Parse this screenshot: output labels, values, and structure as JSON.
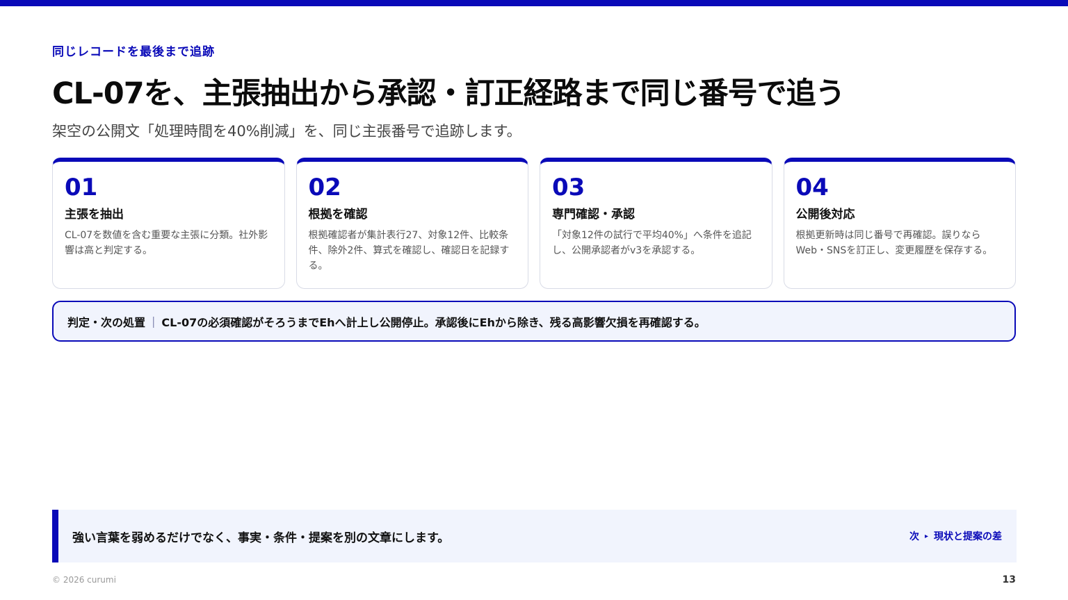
{
  "header": {
    "eyebrow": "同じレコードを最後まで追跡",
    "title": "CL-07を、主張抽出から承認・訂正経路まで同じ番号で追う",
    "subtitle": "架空の公開文「処理時間を40%削減」を、同じ主張番号で追跡します。"
  },
  "steps": [
    {
      "num": "01",
      "title": "主張を抽出",
      "body": "CL-07を数値を含む重要な主張に分類。社外影響は高と判定する。"
    },
    {
      "num": "02",
      "title": "根拠を確認",
      "body": "根拠確認者が集計表行27、対象12件、比較条件、除外2件、算式を確認し、確認日を記録する。"
    },
    {
      "num": "03",
      "title": "専門確認・承認",
      "body": "「対象12件の試行で平均40%」へ条件を追記し、公開承認者がv3を承認する。"
    },
    {
      "num": "04",
      "title": "公開後対応",
      "body": "根拠更新時は同じ番号で再確認。誤りならWeb・SNSを訂正し、変更履歴を保存する。"
    }
  ],
  "verdict": {
    "label": "判定・次の処置",
    "separator": "|",
    "text": "CL-07の必須確認がそろうまでEhへ計上し公開停止。承認後にEhから除き、残る高影響欠損を再確認する。"
  },
  "footer": {
    "message": "強い言葉を弱めるだけでなく、事実・条件・提案を別の文章にします。",
    "next_prefix": "次",
    "next_arrow": "▸",
    "next_label": "現状と提案の差"
  },
  "meta": {
    "copyright": "© 2026 curumi",
    "page_number": "13"
  },
  "colors": {
    "accent": "#0a0ab8",
    "panel": "#f1f4fd"
  }
}
